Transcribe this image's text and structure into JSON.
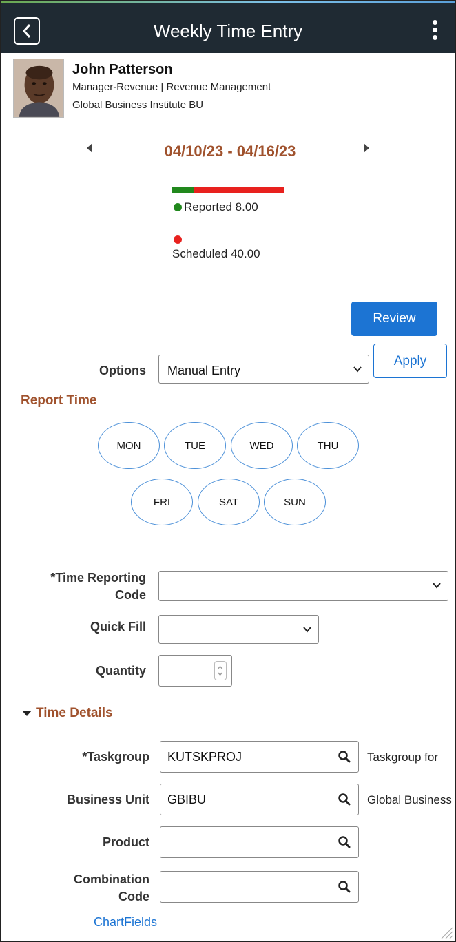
{
  "header": {
    "title": "Weekly Time Entry",
    "back_icon": "chevron-left-icon",
    "menu_icon": "kebab-menu-icon"
  },
  "employee": {
    "name": "John Patterson",
    "job": "Manager-Revenue | Revenue Management",
    "business_unit": "Global Business Institute BU"
  },
  "week": {
    "range": "04/10/23 - 04/16/23"
  },
  "hours": {
    "reported_label": "Reported 8.00",
    "scheduled_label": "Scheduled 40.00",
    "reported": 8.0,
    "scheduled": 40.0,
    "reported_color": "#21881d",
    "scheduled_color": "#e8211e"
  },
  "actions": {
    "review_label": "Review",
    "apply_label": "Apply"
  },
  "options": {
    "label": "Options",
    "value": "Manual Entry"
  },
  "report_time": {
    "title": "Report Time",
    "days": [
      "MON",
      "TUE",
      "WED",
      "THU",
      "FRI",
      "SAT",
      "SUN"
    ]
  },
  "fields": {
    "trc_label_line1": "*Time Reporting",
    "trc_label_line2": "Code",
    "trc_value": "",
    "quick_fill_label": "Quick Fill",
    "quick_fill_value": "",
    "quantity_label": "Quantity",
    "quantity_value": ""
  },
  "time_details": {
    "title": "Time Details",
    "taskgroup_label": "*Taskgroup",
    "taskgroup_value": "KUTSKPROJ",
    "taskgroup_desc": "Taskgroup for",
    "bu_label": "Business Unit",
    "bu_value": "GBIBU",
    "bu_desc": "Global Business",
    "product_label": "Product",
    "product_value": "",
    "combo_label_line1": "Combination",
    "combo_label_line2": "Code",
    "combo_value": "",
    "chartfields_link": "ChartFields"
  },
  "colors": {
    "accent": "#1c74d3",
    "section": "#a0522d",
    "header_bg": "#1f2a33"
  }
}
